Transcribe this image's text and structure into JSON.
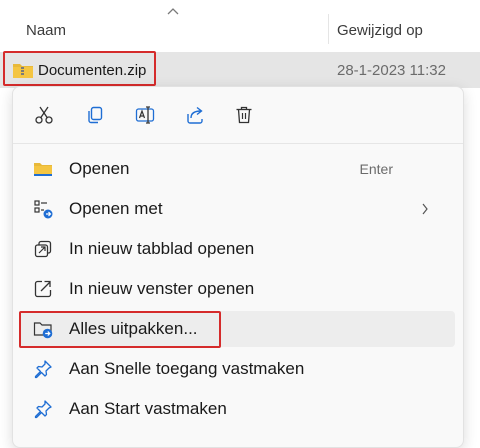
{
  "header": {
    "name_label": "Naam",
    "modified_label": "Gewijzigd op"
  },
  "file": {
    "name": "Documenten.zip",
    "modified": "28-1-2023 11:32",
    "icon": "zip-folder-icon"
  },
  "context_menu": {
    "quick_actions": [
      {
        "icon": "cut-icon"
      },
      {
        "icon": "copy-icon"
      },
      {
        "icon": "rename-icon"
      },
      {
        "icon": "share-icon"
      },
      {
        "icon": "delete-icon"
      }
    ],
    "items": [
      {
        "label": "Openen",
        "shortcut": "Enter",
        "icon": "folder-icon"
      },
      {
        "label": "Openen met",
        "icon": "open-with-icon",
        "submenu": true
      },
      {
        "label": "In nieuw tabblad openen",
        "icon": "new-tab-icon"
      },
      {
        "label": "In nieuw venster openen",
        "icon": "new-window-icon"
      },
      {
        "label": "Alles uitpakken...",
        "icon": "extract-icon",
        "highlighted": true
      },
      {
        "label": "Aan Snelle toegang vastmaken",
        "icon": "pin-icon"
      },
      {
        "label": "Aan Start vastmaken",
        "icon": "pin-icon"
      }
    ]
  },
  "colors": {
    "accent": "#1f6ed4",
    "selection": "#e5e5e5",
    "highlight_border": "#d52b2b",
    "folder_yellow": "#f4c542"
  }
}
